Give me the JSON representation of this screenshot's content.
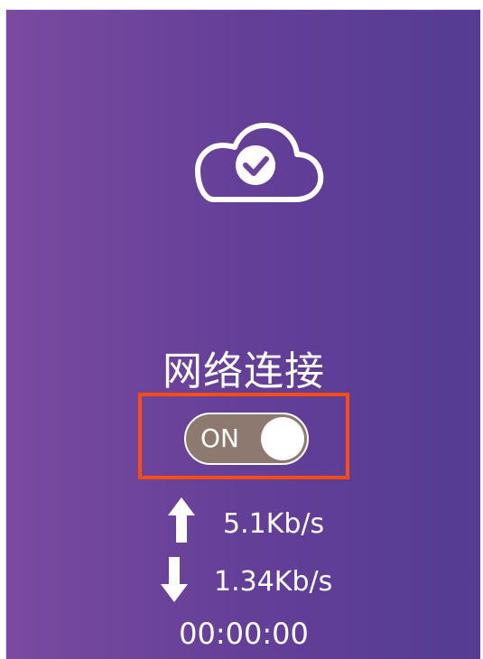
{
  "title": "网络连接",
  "toggle": {
    "label": "ON",
    "state": "on"
  },
  "stats": {
    "upload_speed": "5.1Kb/s",
    "download_speed": "1.34Kb/s",
    "elapsed_time": "00:00:00"
  },
  "icons": {
    "status": "cloud-check-icon",
    "upload": "arrow-up-icon",
    "download": "arrow-down-icon"
  },
  "colors": {
    "background_gradient_start": "#7a4aa0",
    "background_gradient_end": "#553c93",
    "toggle_track": "#8d7970",
    "highlight_border": "#ff4c12",
    "text": "#ffffff"
  }
}
